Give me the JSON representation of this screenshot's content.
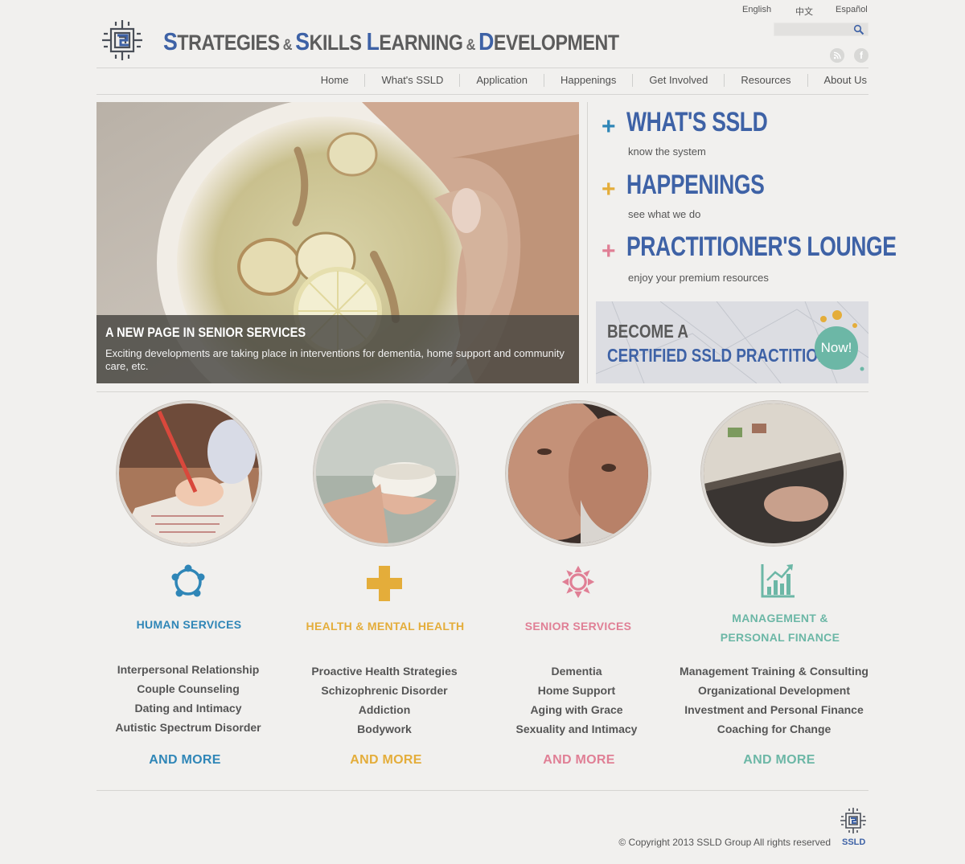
{
  "brand": {
    "title_parts": [
      {
        "cap": "S",
        "rest": "TRATEGIES"
      },
      {
        "amp": "&"
      },
      {
        "cap": "S",
        "rest": "KILLS"
      },
      {
        "cap": "L",
        "rest": "EARNING"
      },
      {
        "amp": "&"
      },
      {
        "cap": "D",
        "rest": "EVELOPMENT"
      }
    ],
    "accent": "#3e62a6"
  },
  "languages": [
    "English",
    "中文",
    "Español"
  ],
  "search": {
    "placeholder": ""
  },
  "nav": [
    "Home",
    "What's SSLD",
    "Application",
    "Happenings",
    "Get Involved",
    "Resources",
    "About Us"
  ],
  "hero": {
    "caption_title": "A NEW PAGE IN SENIOR SERVICES",
    "caption_text": "Exciting developments are taking place in interventions for dementia, home support and community care, etc."
  },
  "quick_links": [
    {
      "title": "WHAT'S SSLD",
      "subtitle": "know the system",
      "plus_color": "#2f86b7"
    },
    {
      "title": "HAPPENINGS",
      "subtitle": "see what we do",
      "plus_color": "#e4ad3a"
    },
    {
      "title": "PRACTITIONER'S LOUNGE",
      "subtitle": "enjoy your premium resources",
      "plus_color": "#e07f95"
    }
  ],
  "banner": {
    "line1": "BECOME A",
    "line2": "CERTIFIED SSLD PRACTITIONER",
    "badge": "Now!"
  },
  "services": [
    {
      "title": "HUMAN SERVICES",
      "color": "#2f86b7",
      "icon": "people-circle-icon",
      "items": [
        "Interpersonal Relationship",
        "Couple Counseling",
        "Dating and Intimacy",
        "Autistic Spectrum Disorder"
      ],
      "more": "AND MORE"
    },
    {
      "title": "HEALTH & MENTAL HEALTH",
      "color": "#e4ad3a",
      "icon": "medical-cross-icon",
      "items": [
        "Proactive Health Strategies",
        "Schizophrenic Disorder",
        "Addiction",
        "Bodywork"
      ],
      "more": "AND MORE"
    },
    {
      "title": "SENIOR SERVICES",
      "color": "#e07f95",
      "icon": "lotus-icon",
      "items": [
        "Dementia",
        "Home Support",
        "Aging with Grace",
        "Sexuality and Intimacy"
      ],
      "more": "AND MORE"
    },
    {
      "title_lines": [
        "MANAGEMENT &",
        "PERSONAL FINANCE"
      ],
      "color": "#6cb7a6",
      "icon": "growth-chart-icon",
      "items": [
        "Management Training & Consulting",
        "Organizational Development",
        "Investment and Personal Finance",
        "Coaching for Change"
      ],
      "more": "AND MORE"
    }
  ],
  "footer": {
    "copyright": "© Copyright 2013 SSLD Group All rights reserved",
    "logo_label": "SSLD"
  }
}
